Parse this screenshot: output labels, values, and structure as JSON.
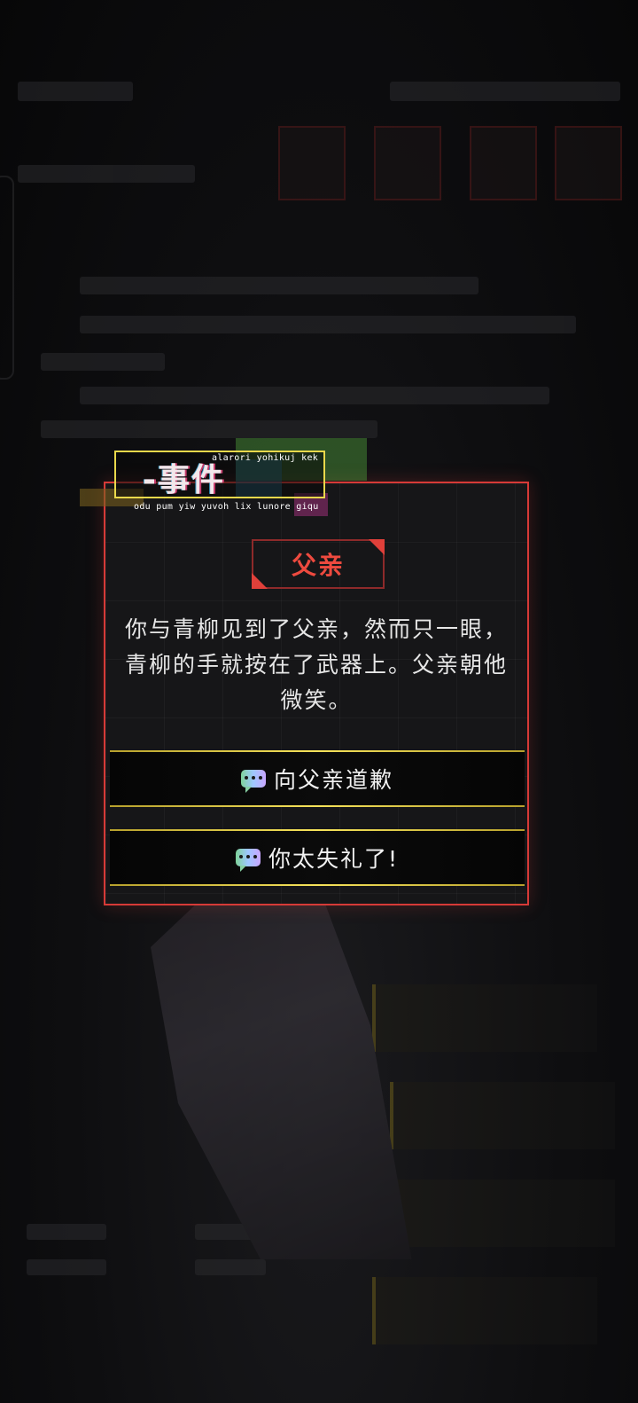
{
  "event_header": {
    "title": "-事件",
    "subtitle_top": "alarori yohikuj kek",
    "subtitle_bottom": "odu pum yiw yuvoh lix lunore giqu"
  },
  "dialog": {
    "speaker": "父亲",
    "text": "你与青柳见到了父亲，然而只一眼，青柳的手就按在了武器上。父亲朝他微笑。",
    "choices": [
      {
        "label": "向父亲道歉",
        "icon": "chat-bubble-icon"
      },
      {
        "label": "你太失礼了!",
        "icon": "chat-bubble-icon"
      }
    ]
  },
  "colors": {
    "dialog_border": "#d63a37",
    "speaker_text": "#ee4a3f",
    "tag_border": "#e9d84b",
    "choice_line": "#f6e35a"
  }
}
